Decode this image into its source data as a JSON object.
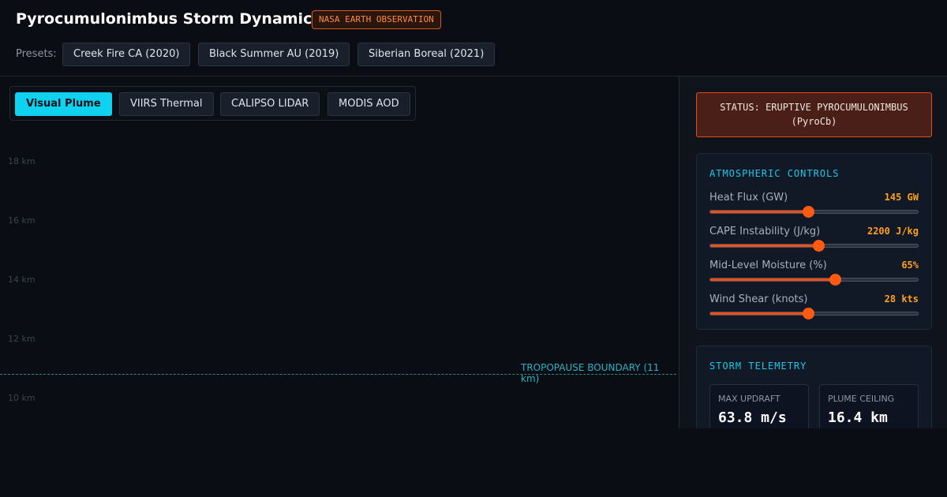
{
  "header": {
    "title": "Pyrocumulonimbus Storm Dynamics",
    "badge": "NASA EARTH OBSERVATION",
    "presets_label": "Presets:",
    "presets": [
      "Creek Fire CA (2020)",
      "Black Summer AU (2019)",
      "Siberian Boreal (2021)"
    ]
  },
  "tabs": [
    {
      "label": "Visual Plume",
      "active": true
    },
    {
      "label": "VIIRS Thermal",
      "active": false
    },
    {
      "label": "CALIPSO LIDAR",
      "active": false
    },
    {
      "label": "MODIS AOD",
      "active": false
    }
  ],
  "plot": {
    "altitude_labels": [
      "18 km",
      "16 km",
      "14 km",
      "12 km",
      "10 km"
    ],
    "tropopause_label": "TROPOPAUSE BOUNDARY (11 km)"
  },
  "status": {
    "line1": "STATUS: ERUPTIVE PYROCUMULONIMBUS",
    "line2": "(PyroCb)"
  },
  "controls": {
    "title": "ATMOSPHERIC CONTROLS",
    "items": [
      {
        "label": "Heat Flux (GW)",
        "value": "145 GW",
        "level": 0.47
      },
      {
        "label": "CAPE Instability (J/kg)",
        "value": "2200 J/kg",
        "level": 0.52
      },
      {
        "label": "Mid-Level Moisture (%)",
        "value": "65%",
        "level": 0.6
      },
      {
        "label": "Wind Shear (knots)",
        "value": "28 kts",
        "level": 0.47
      }
    ]
  },
  "telemetry": {
    "title": "STORM TELEMETRY",
    "max_updraft_label": "MAX UPDRAFT",
    "max_updraft_value": "63.8 m/s",
    "plume_ceiling_label": "PLUME CEILING",
    "plume_ceiling_value": "16.4 km"
  },
  "colors": {
    "accent_cyan": "#0fd2f0",
    "accent_orange": "#f24e12",
    "value_amber": "#ffa11a"
  }
}
